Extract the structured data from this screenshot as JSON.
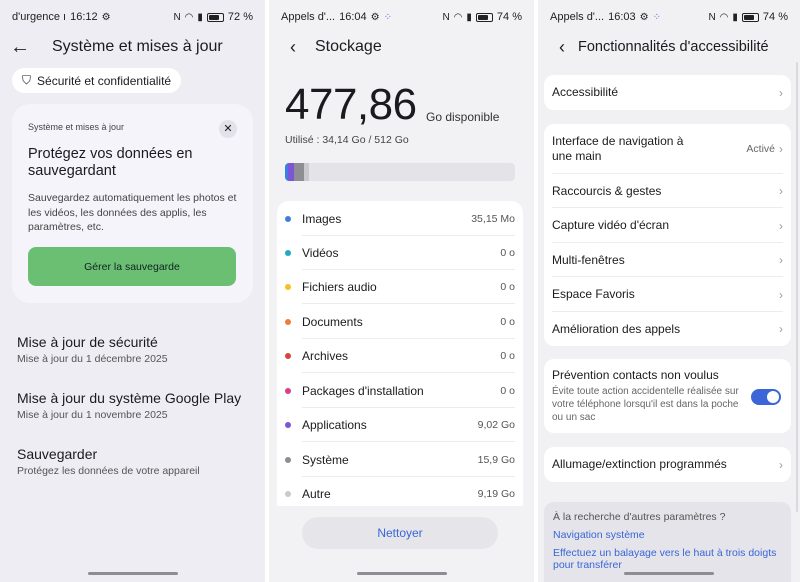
{
  "screen1": {
    "status": {
      "left": "d'urgence ı",
      "time": "16:12",
      "battery": "72 %"
    },
    "title": "Système et mises à jour",
    "chip": "Sécurité et confidentialité",
    "card": {
      "small": "Système et mises à jour",
      "heading": "Protégez vos données en sauvegardant",
      "body": "Sauvegardez automatiquement les photos et les vidéos, les données des applis, les paramètres, etc.",
      "button": "Gérer la sauvegarde"
    },
    "items": [
      {
        "title": "Mise à jour de sécurité",
        "sub": "Mise à jour du 1 décembre 2025"
      },
      {
        "title": "Mise à jour du système Google Play",
        "sub": "Mise à jour du 1 novembre 2025"
      },
      {
        "title": "Sauvegarder",
        "sub": "Protégez les données de votre appareil"
      }
    ]
  },
  "screen2": {
    "status": {
      "left": "Appels d'...",
      "time": "16:04",
      "battery": "74 %"
    },
    "title": "Stockage",
    "available": "477,86",
    "available_unit": "Go disponible",
    "used": "Utilisé : 34,14 Go / 512 Go",
    "rows": [
      {
        "label": "Images",
        "value": "35,15 Mo",
        "color": "#3d7fe0"
      },
      {
        "label": "Vidéos",
        "value": "0 o",
        "color": "#24a7c8"
      },
      {
        "label": "Fichiers audio",
        "value": "0 o",
        "color": "#f3c21e"
      },
      {
        "label": "Documents",
        "value": "0 o",
        "color": "#ef7d35"
      },
      {
        "label": "Archives",
        "value": "0 o",
        "color": "#d8463a"
      },
      {
        "label": "Packages d'installation",
        "value": "0 o",
        "color": "#e03c86"
      },
      {
        "label": "Applications",
        "value": "9,02 Go",
        "color": "#7a55d6"
      },
      {
        "label": "Système",
        "value": "15,9 Go",
        "color": "#8d8d93"
      },
      {
        "label": "Autre",
        "value": "9,19 Go",
        "color": "#c9c9ce"
      }
    ],
    "clean_button": "Nettoyer"
  },
  "screen3": {
    "status": {
      "left": "Appels d'...",
      "time": "16:03",
      "battery": "74 %"
    },
    "title": "Fonctionnalités d'accessibilité",
    "accessibility": "Accessibilité",
    "group": [
      {
        "label": "Interface de navigation à une main",
        "state": "Activé"
      },
      {
        "label": "Raccourcis & gestes"
      },
      {
        "label": "Capture vidéo d'écran"
      },
      {
        "label": "Multi-fenêtres"
      },
      {
        "label": "Espace Favoris"
      },
      {
        "label": "Amélioration des appels"
      }
    ],
    "prevention": {
      "title": "Prévention contacts non voulus",
      "desc": "Évite toute action accidentelle réalisée sur votre téléphone lorsqu'il est dans la poche ou un sac",
      "enabled": true
    },
    "schedule": "Allumage/extinction programmés",
    "search": {
      "question": "À la recherche d'autres paramètres ?",
      "link1": "Navigation système",
      "link2": "Effectuez un balayage vers le haut à trois doigts pour transférer"
    }
  }
}
